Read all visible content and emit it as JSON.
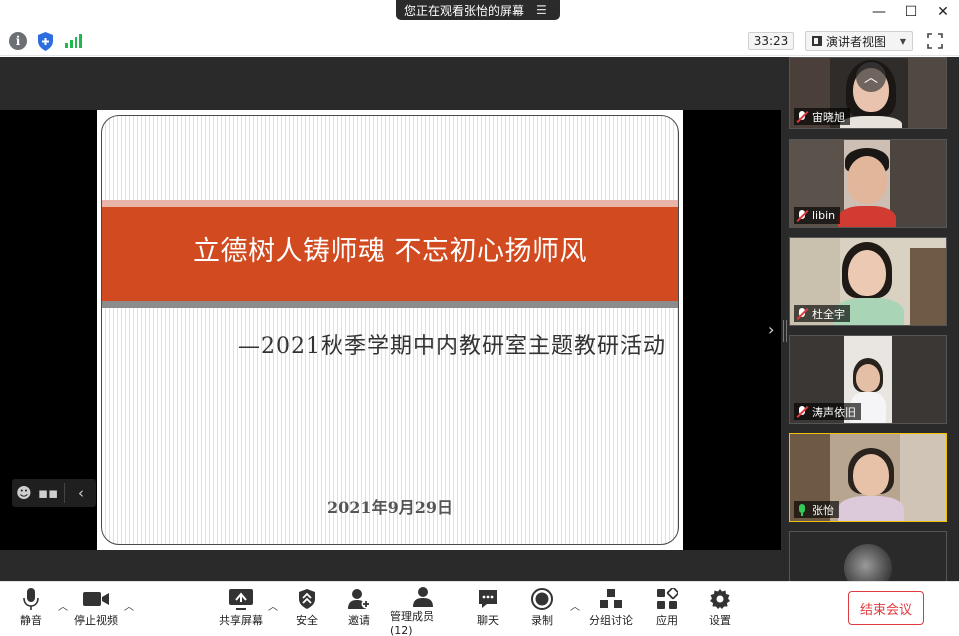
{
  "titlebar": {
    "share_banner": "您正在观看张怡的屏幕",
    "menu_icon": "hamburger-icon",
    "controls": [
      "minimize-icon",
      "maximize-icon",
      "close-icon"
    ]
  },
  "toprow": {
    "info_icon_glyph": "i",
    "timer": "33:23",
    "view_label": "演讲者视图",
    "signal_color": "#1fb84a"
  },
  "slide": {
    "title": "立德树人铸师魂  不忘初心扬师风",
    "subtitle": "—2021秋季学期中内教研室主题教研活动",
    "date": "2021年9月29日",
    "band_color": "#d24a1f"
  },
  "gallery": {
    "participants": [
      {
        "name": "宙晓旭",
        "muted": true
      },
      {
        "name": "libin",
        "muted": true
      },
      {
        "name": "杜全宇",
        "muted": true
      },
      {
        "name": "涛声依旧",
        "muted": true
      },
      {
        "name": "张怡",
        "muted": false
      }
    ]
  },
  "bottombar": {
    "mute_label": "静音",
    "stop_video_label": "停止视频",
    "share_label": "共享屏幕",
    "security_label": "安全",
    "invite_label": "邀请",
    "participants_label": "管理成员(12)",
    "chat_label": "聊天",
    "record_label": "录制",
    "breakout_label": "分组讨论",
    "apps_label": "应用",
    "settings_label": "设置",
    "end_label": "结束会议",
    "end_color": "#e0393e"
  }
}
